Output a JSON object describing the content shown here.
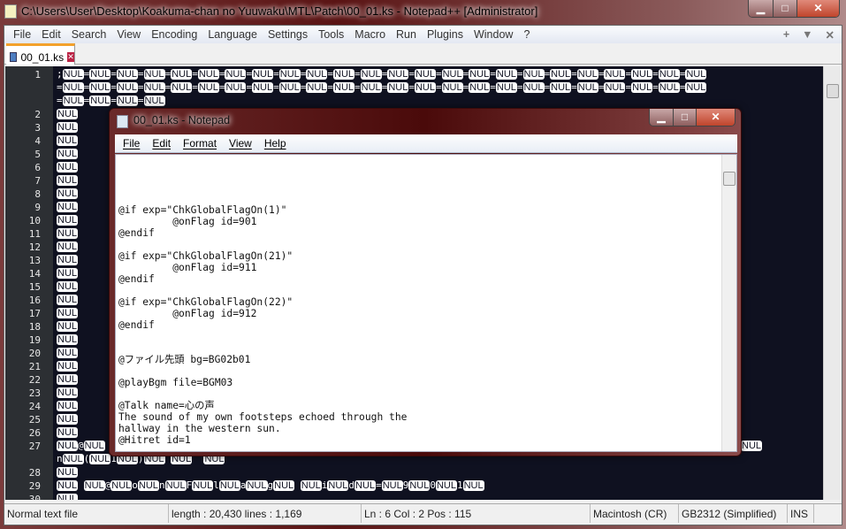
{
  "window": {
    "title": "C:\\Users\\User\\Desktop\\Koakuma-chan no Yuuwaku\\MTL\\Patch\\00_01.ks - Notepad++ [Administrator]",
    "minimize": "▁",
    "maximize": "□",
    "close": "✕"
  },
  "menu": [
    "File",
    "Edit",
    "Search",
    "View",
    "Encoding",
    "Language",
    "Settings",
    "Tools",
    "Macro",
    "Run",
    "Plugins",
    "Window",
    "?"
  ],
  "menu_right": [
    "+",
    "▼",
    "✕"
  ],
  "tab": {
    "label": "00_01.ks",
    "close": "✕"
  },
  "editor": {
    "lines": [
      {
        "n": "1",
        "rows": [
          ";NUL=NUL=NUL=NUL=NUL=NUL=NUL=NUL=NUL=NUL=NUL=NUL=NUL=NUL=NUL=NUL=NUL=NUL=NUL=NUL=NUL=NUL=NUL=NUL",
          "=NUL=NUL=NUL=NUL=NUL=NUL=NUL=NUL=NUL=NUL=NUL=NUL=NUL=NUL=NUL=NUL=NUL=NUL=NUL=NUL=NUL=NUL=NUL=NUL",
          "=NUL=NUL=NUL=NUL"
        ]
      },
      {
        "n": "2",
        "rows": [
          "NUL"
        ]
      },
      {
        "n": "3",
        "rows": [
          "NUL"
        ]
      },
      {
        "n": "4",
        "rows": [
          "NUL"
        ]
      },
      {
        "n": "5",
        "rows": [
          "NUL"
        ]
      },
      {
        "n": "6",
        "rows": [
          "NUL"
        ]
      },
      {
        "n": "7",
        "rows": [
          "NUL"
        ]
      },
      {
        "n": "8",
        "rows": [
          "NUL"
        ]
      },
      {
        "n": "9",
        "rows": [
          "NUL"
        ]
      },
      {
        "n": "10",
        "rows": [
          "NUL"
        ]
      },
      {
        "n": "11",
        "rows": [
          "NUL"
        ]
      },
      {
        "n": "12",
        "rows": [
          "NUL"
        ]
      },
      {
        "n": "13",
        "rows": [
          "NUL"
        ]
      },
      {
        "n": "14",
        "rows": [
          "NUL"
        ]
      },
      {
        "n": "15",
        "rows": [
          "NUL"
        ]
      },
      {
        "n": "16",
        "rows": [
          "NUL"
        ]
      },
      {
        "n": "17",
        "rows": [
          "NUL"
        ]
      },
      {
        "n": "18",
        "rows": [
          "NUL"
        ]
      },
      {
        "n": "19",
        "rows": [
          "NUL"
        ]
      },
      {
        "n": "20",
        "rows": [
          "NUL"
        ]
      },
      {
        "n": "21",
        "rows": [
          "NUL"
        ]
      },
      {
        "n": "22",
        "rows": [
          "NUL"
        ]
      },
      {
        "n": "23",
        "rows": [
          "NUL"
        ]
      },
      {
        "n": "24",
        "rows": [
          "NUL"
        ]
      },
      {
        "n": "25",
        "rows": [
          "NUL"
        ]
      },
      {
        "n": "26",
        "rows": [
          "NUL"
        ]
      },
      {
        "n": "27",
        "rows": [
          "NUL@NUL                                                                                                        NUL0NUL",
          "nNUL(NUL1NUL)NUL NUL  NUL"
        ]
      },
      {
        "n": "28",
        "rows": [
          "NUL"
        ]
      },
      {
        "n": "29",
        "rows": [
          "NUL NUL@NULoNULnNULFNULlNULaNULgNUL NULiNULdNUL=NUL9NUL0NUL1NUL"
        ]
      },
      {
        "n": "30",
        "rows": [
          "NUL"
        ]
      }
    ]
  },
  "status": {
    "type": "Normal text file",
    "length": "length : 20,430    lines : 1,169",
    "position": "Ln : 6    Col : 2    Pos : 115",
    "eol": "Macintosh (CR)",
    "encoding": "GB2312 (Simplified)",
    "mode": "INS"
  },
  "notepad": {
    "title": "00_01.ks - Notepad",
    "menu": [
      "File",
      "Edit",
      "Format",
      "View",
      "Help"
    ],
    "content": "\n\n\n\n@if exp=\"ChkGlobalFlagOn(1)\"\n         @onFlag id=901\n@endif\n\n@if exp=\"ChkGlobalFlagOn(21)\"\n         @onFlag id=911\n@endif\n\n@if exp=\"ChkGlobalFlagOn(22)\"\n         @onFlag id=912\n@endif\n\n\n@ファイル先頭 bg=BG02b01\n\n@playBgm file=BGM03\n\n@Talk name=心の声\nThe sound of my own footsteps echoed through the\nhallway in the western sun.\n@Hitret id=1"
  }
}
